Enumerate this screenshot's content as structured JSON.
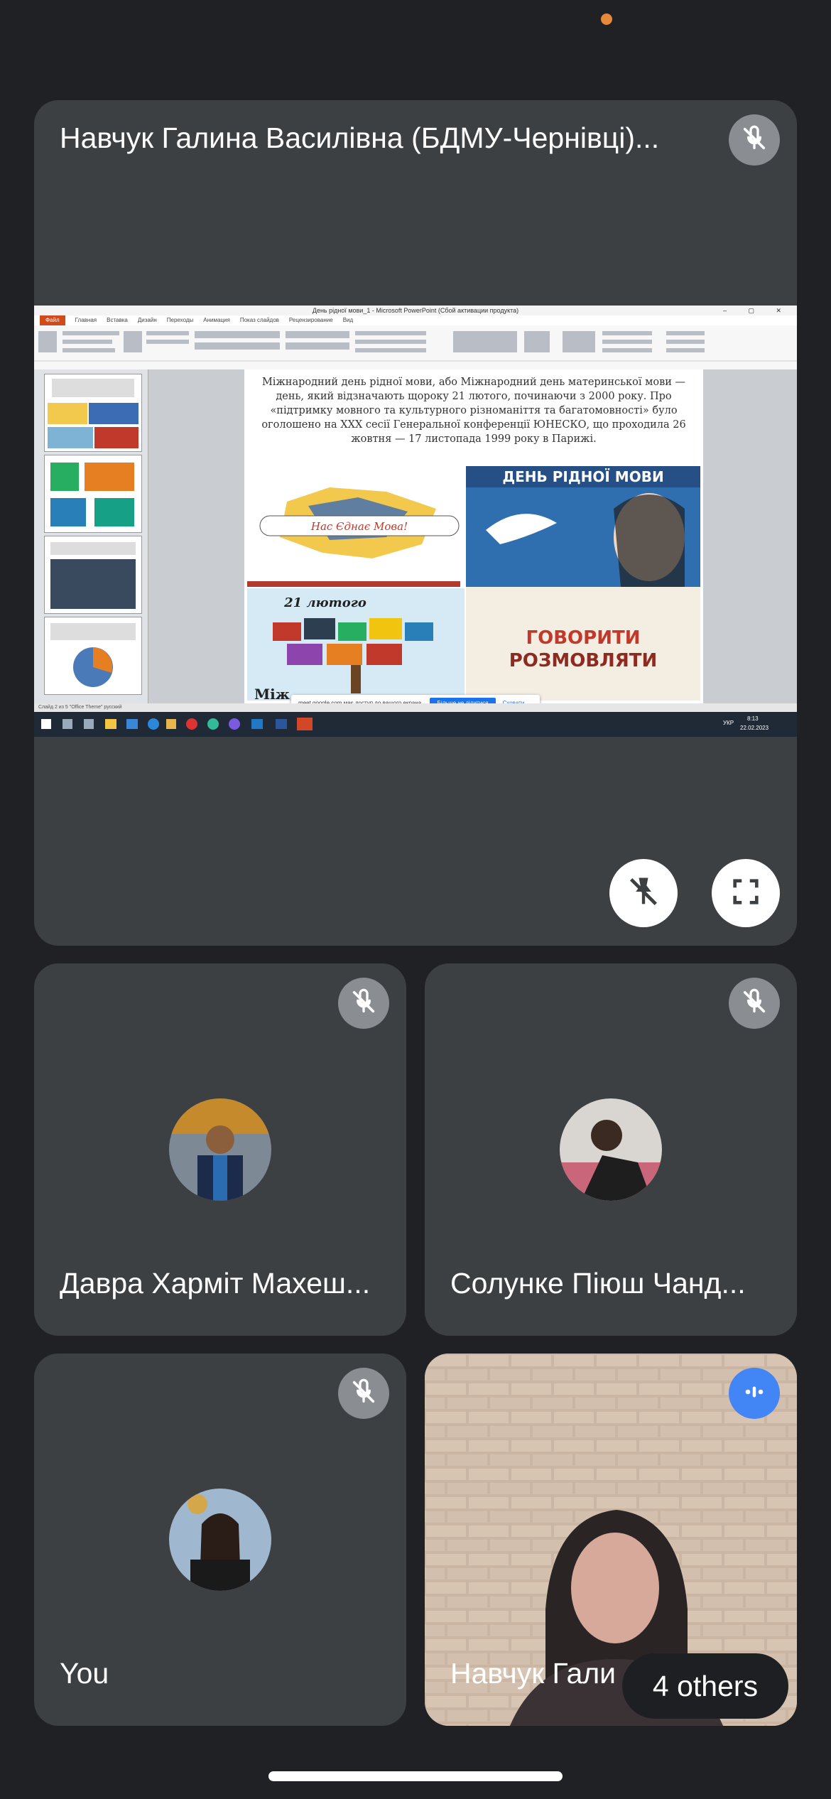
{
  "top_tile": {
    "name": "Навчук Галина Василівна (БДМУ-Чернівці)..."
  },
  "presentation": {
    "window_title": "День рідної мови_1 - Microsoft PowerPoint (Сбой активации продукта)",
    "menu": [
      "Файл",
      "Главная",
      "Вставка",
      "Дизайн",
      "Переходы",
      "Анимация",
      "Показ слайдов",
      "Рецензирование",
      "Вид"
    ],
    "slide_text": "Міжнародний день рідної мови, або Міжнародний день материнської мови — день, який відзначають щороку 21 лютого, починаючи з 2000 року. Про «підтримку мовного та культурного різноманіття та багатомовності» було оголошено на ХХХ сесії Генеральної конференції ЮНЕСКО, що проходила 26 жовтня — 17 листопада 1999 року в Парижі.",
    "img_ribbon_text": "Нас Єднає Мова!",
    "img_poster_title": "ДЕНЬ РІДНОЇ МОВИ",
    "img_date": "21 лютого",
    "img_words_1": "ГОВОРИТИ",
    "img_words_2": "РОЗМОВЛЯТИ",
    "img_bottom_partial": "Між",
    "status": "Слайд 2 из 5   \"Office Theme\"   русский",
    "share_notice": "meet.google.com має доступ до вашого екрана.",
    "share_stop": "Більше не ділитися",
    "share_hide": "Сховати",
    "taskbar_lang": "УКР",
    "taskbar_time": "8:13",
    "taskbar_date": "22.02.2023"
  },
  "tiles": [
    {
      "name": "Давра Харміт Махеш..."
    },
    {
      "name": "Солунке Піюш Чанд..."
    },
    {
      "name": "You"
    },
    {
      "name": "Навчук Гали"
    }
  ],
  "others_label": "4 others",
  "colors": {
    "background": "#202124",
    "tile": "#3c4043",
    "speaking": "#4285f4",
    "notification_dot": "#e8883a"
  },
  "icons": {
    "mute": "mic-off-icon",
    "pin": "unpin-icon",
    "fullscreen": "fullscreen-icon",
    "speaking": "audio-level-icon"
  }
}
